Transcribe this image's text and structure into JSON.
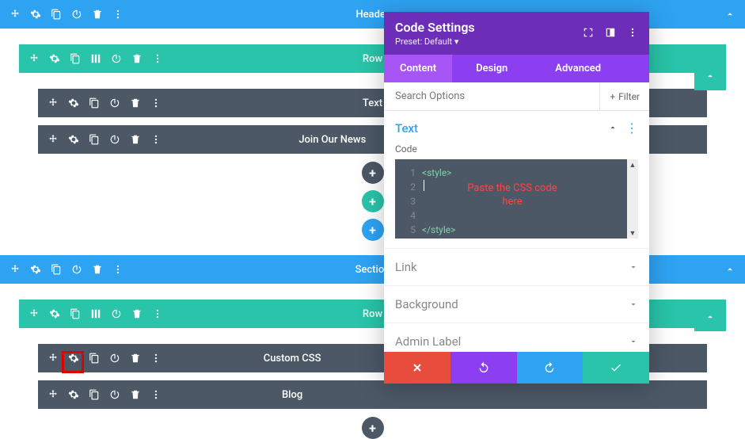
{
  "section1": {
    "label": "Header"
  },
  "row1": {
    "label": "Row"
  },
  "module_text": {
    "label": "Text"
  },
  "module_news": {
    "label": "Join Our News"
  },
  "section2": {
    "label": "Section"
  },
  "row2": {
    "label": "Row"
  },
  "module_css": {
    "label": "Custom CSS"
  },
  "module_blog": {
    "label": "Blog"
  },
  "modal": {
    "title": "Code Settings",
    "preset": "Preset: Default",
    "tabs": {
      "content": "Content",
      "design": "Design",
      "advanced": "Advanced"
    },
    "search_placeholder": "Search Options",
    "filter": "Filter",
    "text_group": "Text",
    "code_label": "Code",
    "code": {
      "l1": "<style>",
      "l5": "</style>",
      "annotation_l1": "Paste the CSS code",
      "annotation_l2": "here"
    },
    "acc": {
      "link": "Link",
      "background": "Background",
      "admin": "Admin Label"
    }
  }
}
